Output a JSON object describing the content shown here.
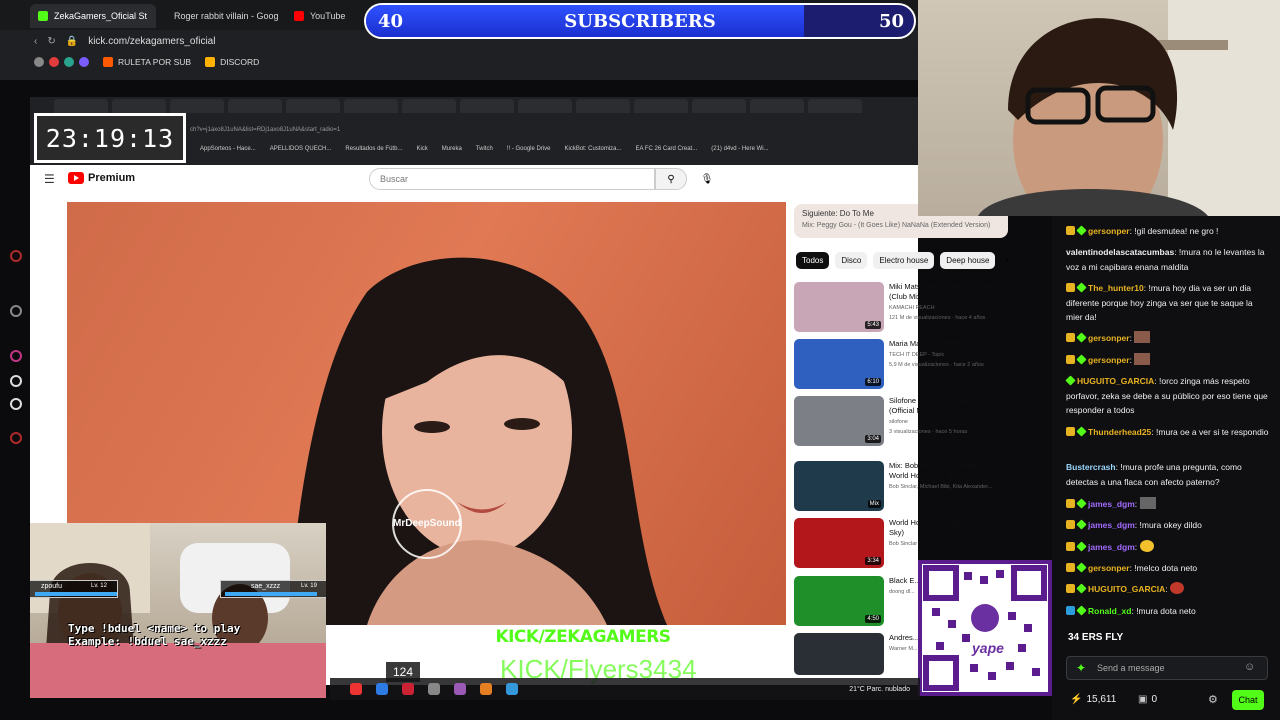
{
  "browser": {
    "tabs": [
      {
        "label": "ZekaGamers_Oficial St",
        "color": "#53fc18",
        "active": true
      },
      {
        "label": "Roger rabbit villain - Goog",
        "color": "#4285f4",
        "active": false
      },
      {
        "label": "YouTube",
        "color": "#ff0000",
        "active": false
      }
    ],
    "url": "kick.com/zekagamers_oficial",
    "bookmarks": [
      "RULETA POR SUB",
      "DISCORD"
    ]
  },
  "sub_goal": {
    "current": "40",
    "label": "SUBSCRIBERS",
    "target": "50",
    "progress": 0.8
  },
  "timer": "23:19:13",
  "inner_browser": {
    "url": "ch?v=j1axo8J1uNA&list=RDj1axo8J1uNA&start_radio=1",
    "bookmarks": [
      "AppSorteos - Hace...",
      "APELLIDOS QUECH...",
      "Resultados de Fútb...",
      "Kick",
      "Mureka",
      "Twitch",
      "!! - Google Drive",
      "KickBot: Customiza...",
      "EA FC 26 Card Creat...",
      "(21) d4vd - Here Wi..."
    ]
  },
  "youtube": {
    "brand": "Premium",
    "search_placeholder": "Buscar",
    "up_next_label": "Siguiente: Do To Me",
    "up_next_sub": "Mix: Peggy Gou - (It Goes Like) NaNaNa (Extended Version)",
    "chips": [
      "Todos",
      "Disco",
      "Electro house",
      "Deep house"
    ],
    "overlay_logo": "MrDeepSound",
    "recommendations": [
      {
        "title": "Miki Matsubara - Stay With Me HD (Club Mix)",
        "channel": "KAMACHI PEACH",
        "meta": "121 M de visualizaciones · hace 4 años",
        "duration": "5:43",
        "color": "#c9a6b6"
      },
      {
        "title": "Maria Maria (Extended)",
        "channel": "TECH IT DEEP - Topic",
        "meta": "5,9 M de visualizaciones · hace 2 años",
        "duration": "6:10",
        "color": "#2f5fbf"
      },
      {
        "title": "Silofone - George in the sun (Official Music Video)",
        "channel": "silofone",
        "meta": "3 visualizaciones · hace 5 horas",
        "duration": "3:04",
        "color": "#7d7f86"
      },
      {
        "title": "Mix: Bob Sinclar Vs Peggy Gou - World Hold On X Nanana ...",
        "channel": "Bob Sinclar, Michael Bibi, Kita Alexander...",
        "meta": "",
        "duration": "Mix",
        "color": "#1f3a4a"
      },
      {
        "title": "World Hold On (Children Of The Sky)",
        "channel": "Bob Sinclar",
        "meta": "",
        "duration": "3:34",
        "color": "#b3161b"
      },
      {
        "title": "Black E... Feeling",
        "channel": "doong dl...",
        "meta": "",
        "duration": "4:50",
        "color": "#1f8f2a"
      },
      {
        "title": "Andres... (Video...",
        "channel": "Warner M...",
        "meta": "",
        "duration": "",
        "color": "#2a2e35"
      }
    ]
  },
  "chat": {
    "messages": [
      {
        "user": "gersonper",
        "text": "!gil desmutea! ne gro !",
        "color": "#e8b321"
      },
      {
        "user": "valentinodelascatacumbas",
        "text": "!mura no le levantes la voz a mi capibara enana maldita",
        "color": "#efeff1"
      },
      {
        "user": "The_hunter10",
        "text": "!mura hoy dia va ser un dia diferente porque hoy zinga va ser que te saque la mier da!",
        "color": "#e8b321"
      },
      {
        "user": "gersonper",
        "text": "",
        "color": "#e8b321"
      },
      {
        "user": "gersonper",
        "text": "",
        "color": "#e8b321"
      },
      {
        "user": "HUGUITO_GARCIA",
        "text": "!orco zinga más respeto porfavor, zeka se debe a su público por eso tiene que responder a todos",
        "color": "#e8b321"
      },
      {
        "user": "Thunderhead25",
        "text": "!mura oe a ver si te respondio",
        "color": "#e8b321"
      },
      {
        "user": "Bustercrash",
        "text": "!mura profe una pregunta, como detectas a una flaca con afecto paterno?",
        "color": "#9ad7ff"
      },
      {
        "user": "james_dgm",
        "text": "",
        "color": "#a36bff"
      },
      {
        "user": "james_dgm",
        "text": "!mura okey dildo",
        "color": "#a36bff"
      },
      {
        "user": "james_dgm",
        "text": "",
        "color": "#a36bff"
      },
      {
        "user": "gersonper",
        "text": "!melco dota neto",
        "color": "#e8b321"
      },
      {
        "user": "HUGUITO_GARCIA",
        "text": "",
        "color": "#e8b321"
      },
      {
        "user": "Ronald_xd",
        "text": "!mura dota neto",
        "color": "#53fc18"
      }
    ],
    "input_placeholder": "Send a message",
    "viewers": "15,611",
    "other_count": "0",
    "send_label": "Chat"
  },
  "overlays": {
    "kick_tag": "KICK/ZEKAGAMERS",
    "flyers": "KICK/Flyers3434",
    "duel_line1": "Type !bduel <name> to play",
    "duel_line2": "Example: !bduel sae_xzzz",
    "player1": "zpoufu",
    "player1_level": "Lv. 12",
    "player2": "sae_xzzz",
    "player2_level": "Lv. 19",
    "count": "124",
    "bits": "34 ERS FLY",
    "weather": "21°C  Parc. nublado",
    "qr_label": "yape"
  }
}
